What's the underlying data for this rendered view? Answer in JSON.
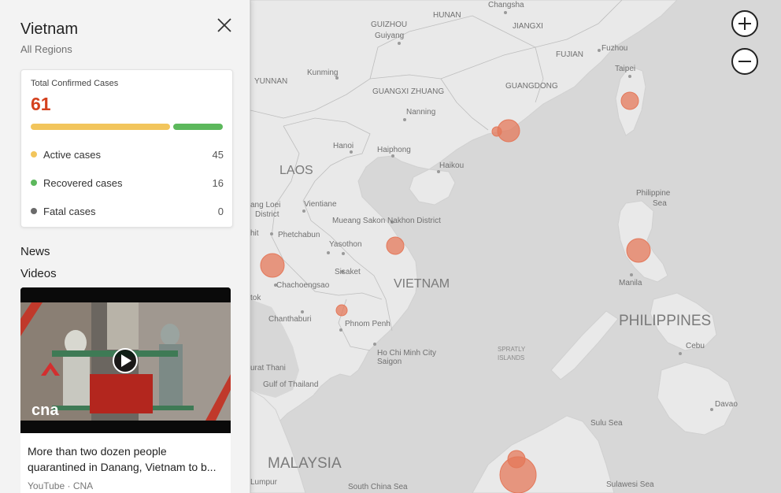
{
  "panel": {
    "title": "Vietnam",
    "subtitle": "All Regions",
    "close_icon": "close-icon"
  },
  "stats": {
    "label": "Total Confirmed Cases",
    "total": "61",
    "colors": {
      "active": "#f2c55c",
      "recovered": "#5cb85c",
      "fatal": "#6b6b6b",
      "total": "#d4411e"
    },
    "rows": [
      {
        "name": "Active cases",
        "value": "45"
      },
      {
        "name": "Recovered cases",
        "value": "16"
      },
      {
        "name": "Fatal cases",
        "value": "0"
      }
    ]
  },
  "sections": {
    "news": "News",
    "videos": "Videos"
  },
  "video": {
    "title_line1": "More than two dozen people",
    "title_line2": "quarantined in Danang, Vietnam to b...",
    "source": "YouTube · CNA",
    "brand": "cna",
    "play_icon": "play-icon"
  },
  "zoom": {
    "in_icon": "zoom-in-icon",
    "out_icon": "zoom-out-icon"
  },
  "map": {
    "bubble_color": "#e4785a",
    "labels": {
      "hunan": "HUNAN",
      "changsha": "Changsha",
      "jiangxi": "JIANGXI",
      "guizhou": "GUIZHOU",
      "guiyang": "Guiyang",
      "fujian": "FUJIAN",
      "fuzhou": "Fuzhou",
      "taipei": "Taipei",
      "yunnan": "YUNNAN",
      "kunming": "Kunming",
      "guangxi": "GUANGXI ZHUANG",
      "guangdong": "GUANGDONG",
      "nanning": "Nanning",
      "hanoi": "Hanoi",
      "haiphong": "Haiphong",
      "haikou": "Haikou",
      "laos": "LAOS",
      "vientiane": "Vientiane",
      "luang": "ang Loei",
      "district": "District",
      "muang": "Mueang Sakon Nakhon District",
      "philippine_sea1": "Philippine",
      "philippine_sea2": "Sea",
      "phetchabun": "Phetchabun",
      "yasothon": "Yasothon",
      "vietnam": "VIETNAM",
      "manila": "Manila",
      "sisaket": "Sisaket",
      "chachoengsao": "Chachoengsao",
      "philippines": "PHILIPPINES",
      "hit": "hit",
      "tok": "tok",
      "chanthaburi": "Chanthaburi",
      "phnompenh": "Phnom Penh",
      "spratly1": "SPRATLY",
      "spratly2": "ISLANDS",
      "hcm": "Ho Chi Minh City",
      "saigon": "Saigon",
      "cebu": "Cebu",
      "suratthani": "urat Thani",
      "gulf": "Gulf of Thailand",
      "davao": "Davao",
      "sulusea": "Sulu Sea",
      "malaysia": "MALAYSIA",
      "lumpur": "Lumpur",
      "scs": "South China Sea",
      "sulawesi": "Sulawesi Sea"
    }
  }
}
